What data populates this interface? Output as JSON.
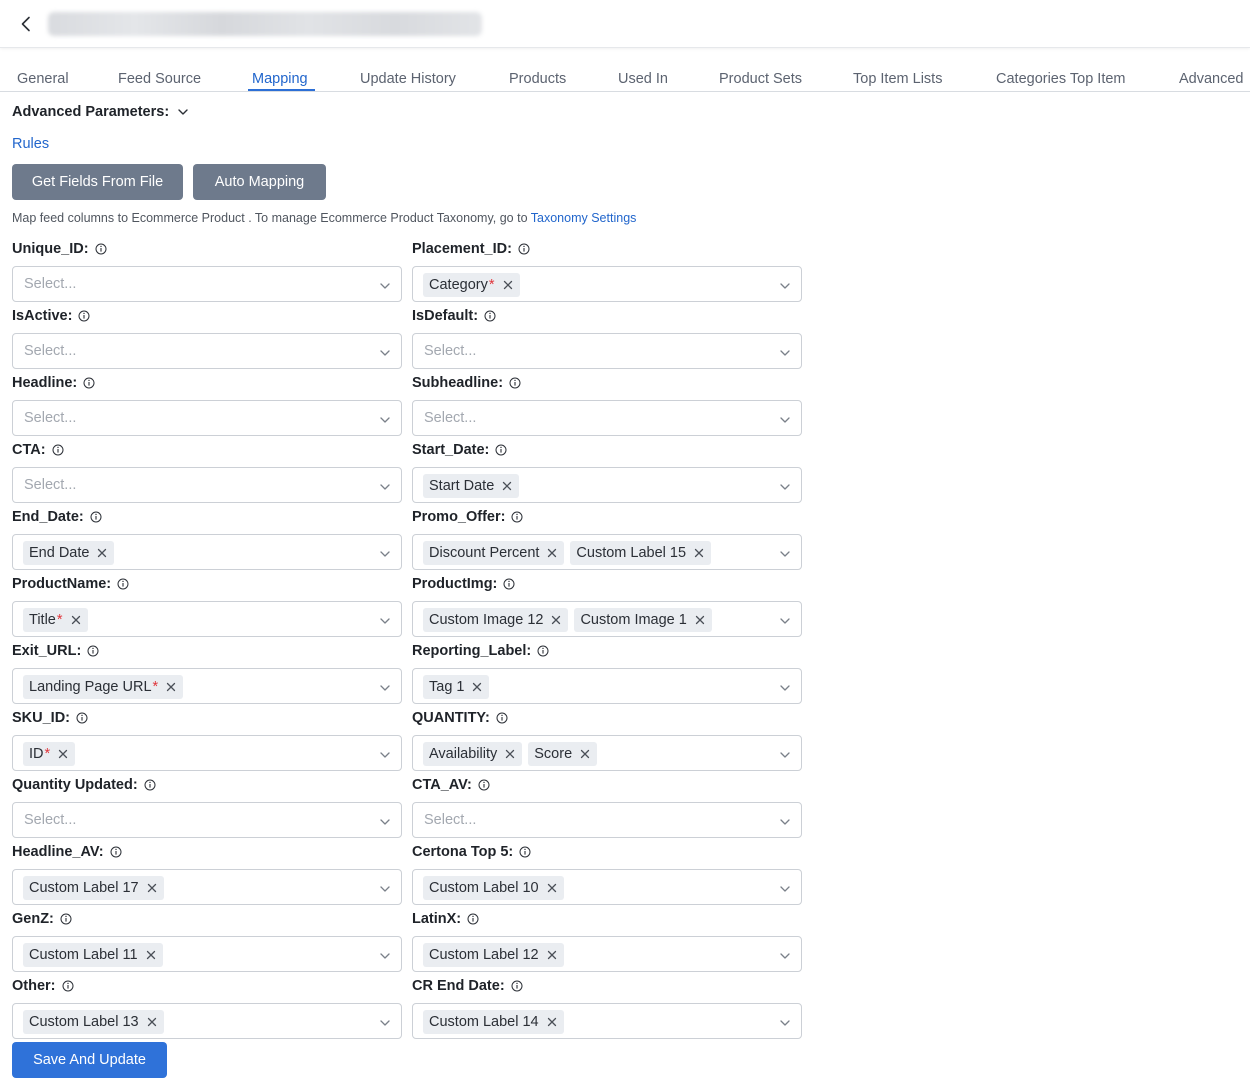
{
  "tabs": [
    {
      "label": "General"
    },
    {
      "label": "Feed Source"
    },
    {
      "label": "Mapping"
    },
    {
      "label": "Update History"
    },
    {
      "label": "Products"
    },
    {
      "label": "Used In"
    },
    {
      "label": "Product Sets"
    },
    {
      "label": "Top Item Lists"
    },
    {
      "label": "Categories Top Item"
    },
    {
      "label": "Advanced"
    }
  ],
  "active_tab": "Mapping",
  "advanced_parameters_label": "Advanced Parameters:",
  "rules_label": "Rules",
  "buttons": {
    "get_fields": "Get Fields From File",
    "auto_mapping": "Auto Mapping",
    "save": "Save And Update"
  },
  "info": {
    "text": "Map feed columns to Ecommerce Product . To manage Ecommerce Product Taxonomy, go to ",
    "link": "Taxonomy Settings"
  },
  "placeholder": "Select...",
  "fields": [
    {
      "label": "Unique_ID:",
      "chips": []
    },
    {
      "label": "Placement_ID:",
      "chips": [
        {
          "text": "Category",
          "required": true
        }
      ]
    },
    {
      "label": "IsActive:",
      "chips": []
    },
    {
      "label": "IsDefault:",
      "chips": []
    },
    {
      "label": "Headline:",
      "chips": []
    },
    {
      "label": "Subheadline:",
      "chips": []
    },
    {
      "label": "CTA:",
      "chips": []
    },
    {
      "label": "Start_Date:",
      "chips": [
        {
          "text": "Start Date",
          "required": false
        }
      ]
    },
    {
      "label": "End_Date:",
      "chips": [
        {
          "text": "End Date",
          "required": false
        }
      ]
    },
    {
      "label": "Promo_Offer:",
      "chips": [
        {
          "text": "Discount Percent",
          "required": false
        },
        {
          "text": "Custom Label 15",
          "required": false
        }
      ]
    },
    {
      "label": "ProductName:",
      "chips": [
        {
          "text": "Title",
          "required": true
        }
      ]
    },
    {
      "label": "ProductImg:",
      "chips": [
        {
          "text": "Custom Image 12",
          "required": false
        },
        {
          "text": "Custom Image 1",
          "required": false
        }
      ]
    },
    {
      "label": "Exit_URL:",
      "chips": [
        {
          "text": "Landing Page URL",
          "required": true
        }
      ]
    },
    {
      "label": "Reporting_Label:",
      "chips": [
        {
          "text": "Tag 1",
          "required": false
        }
      ]
    },
    {
      "label": "SKU_ID:",
      "chips": [
        {
          "text": "ID",
          "required": true
        }
      ]
    },
    {
      "label": "QUANTITY:",
      "chips": [
        {
          "text": "Availability",
          "required": false
        },
        {
          "text": "Score",
          "required": false
        }
      ]
    },
    {
      "label": "Quantity Updated:",
      "chips": []
    },
    {
      "label": "CTA_AV:",
      "chips": []
    },
    {
      "label": "Headline_AV:",
      "chips": [
        {
          "text": "Custom Label 17",
          "required": false
        }
      ]
    },
    {
      "label": "Certona Top 5:",
      "chips": [
        {
          "text": "Custom Label 10",
          "required": false
        }
      ]
    },
    {
      "label": "GenZ:",
      "chips": [
        {
          "text": "Custom Label 11",
          "required": false
        }
      ]
    },
    {
      "label": "LatinX:",
      "chips": [
        {
          "text": "Custom Label 12",
          "required": false
        }
      ]
    },
    {
      "label": "Other:",
      "chips": [
        {
          "text": "Custom Label 13",
          "required": false
        }
      ]
    },
    {
      "label": "CR End Date:",
      "chips": [
        {
          "text": "Custom Label 14",
          "required": false
        }
      ]
    }
  ],
  "required_marker": "*",
  "icons": {
    "back": "chevron-left-icon",
    "advanced_toggle": "chevron-down-icon",
    "field_info": "info-circle-icon",
    "chip_remove": "close-icon",
    "select_caret": "chevron-down-icon"
  },
  "colors": {
    "accent": "#2266cc",
    "primary_button": "#2f72d9",
    "secondary_button": "#6e7a8c",
    "required": "#e0353b",
    "chip_bg": "#eaedf1"
  }
}
